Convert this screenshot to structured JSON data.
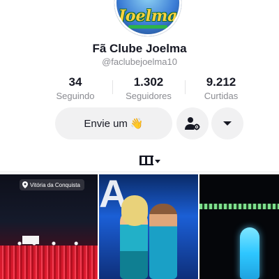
{
  "profile": {
    "avatar_logo_text": "Joelma",
    "display_name": "Fã Clube Joelma",
    "username": "@faclubejoelma10"
  },
  "stats": [
    {
      "value": "34",
      "label": "Seguindo"
    },
    {
      "value": "1.302",
      "label": "Seguidores"
    },
    {
      "value": "9.212",
      "label": "Curtidas"
    }
  ],
  "actions": {
    "message_label": "Envie um",
    "message_emoji": "👋",
    "add_friend_icon": "person-gear-icon",
    "more_icon": "caret-down-icon"
  },
  "tabs": {
    "active_icon": "videos-grid-icon"
  },
  "videos": [
    {
      "location": "Vitória da Conquista"
    },
    {
      "location": ""
    },
    {
      "location": ""
    }
  ],
  "colors": {
    "text": "#161823",
    "secondary_text": "#8a8b91",
    "button_bg": "#f1f1f2"
  }
}
